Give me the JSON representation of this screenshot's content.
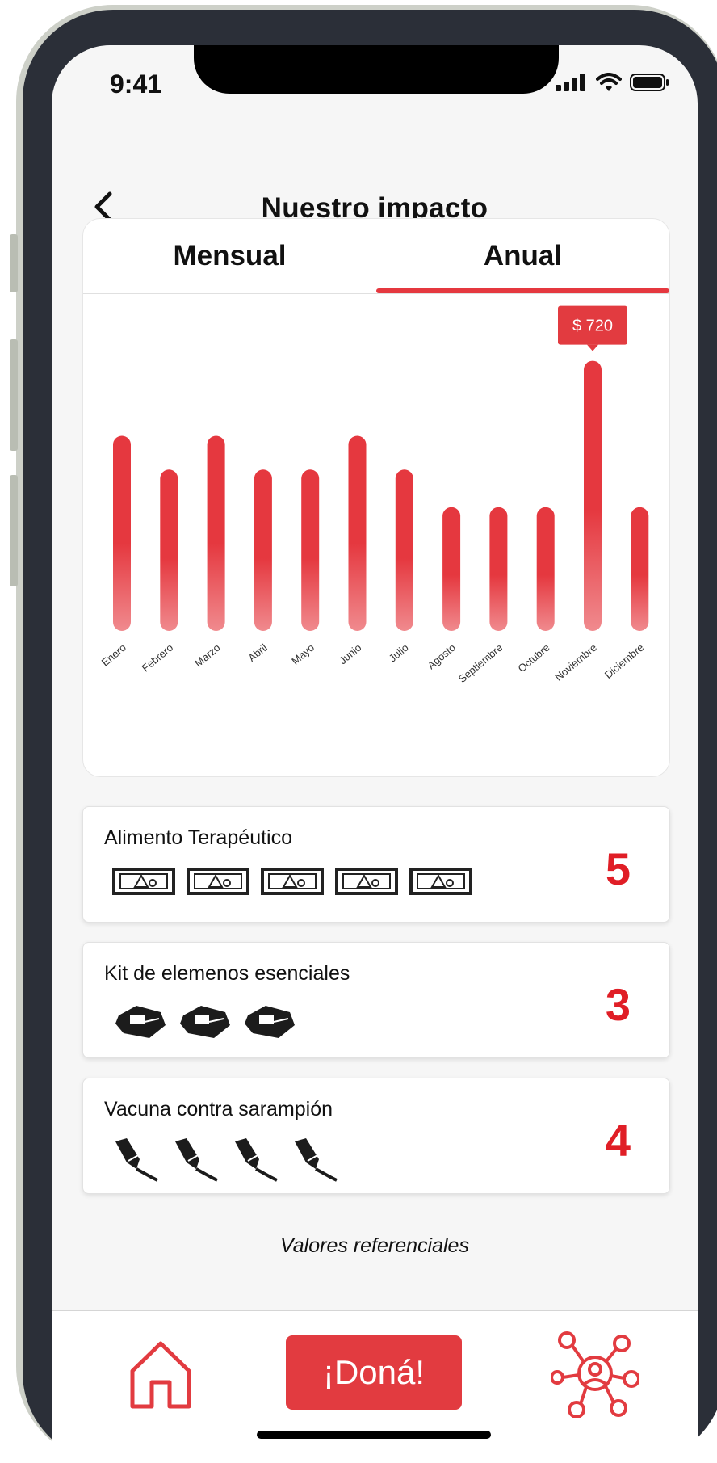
{
  "status_bar": {
    "time": "9:41"
  },
  "header": {
    "title": "Nuestro impacto"
  },
  "tabs": [
    {
      "label": "Mensual",
      "active": false
    },
    {
      "label": "Anual",
      "active": true
    }
  ],
  "chart_data": {
    "type": "bar",
    "categories": [
      "Enero",
      "Febrero",
      "Marzo",
      "Abril",
      "Mayo",
      "Junio",
      "Julio",
      "Agosto",
      "Septiembre",
      "Octubre",
      "Noviembre",
      "Diciembre"
    ],
    "values": [
      520,
      430,
      520,
      430,
      430,
      520,
      430,
      330,
      330,
      330,
      720,
      330
    ],
    "tooltip": {
      "category": "Noviembre",
      "label": "$ 720"
    },
    "ylim": [
      0,
      900
    ],
    "grid": false,
    "accent_color": "#e5383f"
  },
  "items": [
    {
      "title": "Alimento Terapéutico",
      "count": "5",
      "icon": "food-packet-icon",
      "icon_count": 5
    },
    {
      "title": "Kit de elemenos esenciales",
      "count": "3",
      "icon": "kit-bag-icon",
      "icon_count": 3
    },
    {
      "title": "Vacuna contra sarampión",
      "count": "4",
      "icon": "vaccine-syringe-icon",
      "icon_count": 4
    }
  ],
  "footer_note": "Valores referenciales",
  "bottom_nav": {
    "donate_label": "¡Doná!"
  },
  "colors": {
    "accent": "#e5383f",
    "count_red": "#e01e26"
  }
}
